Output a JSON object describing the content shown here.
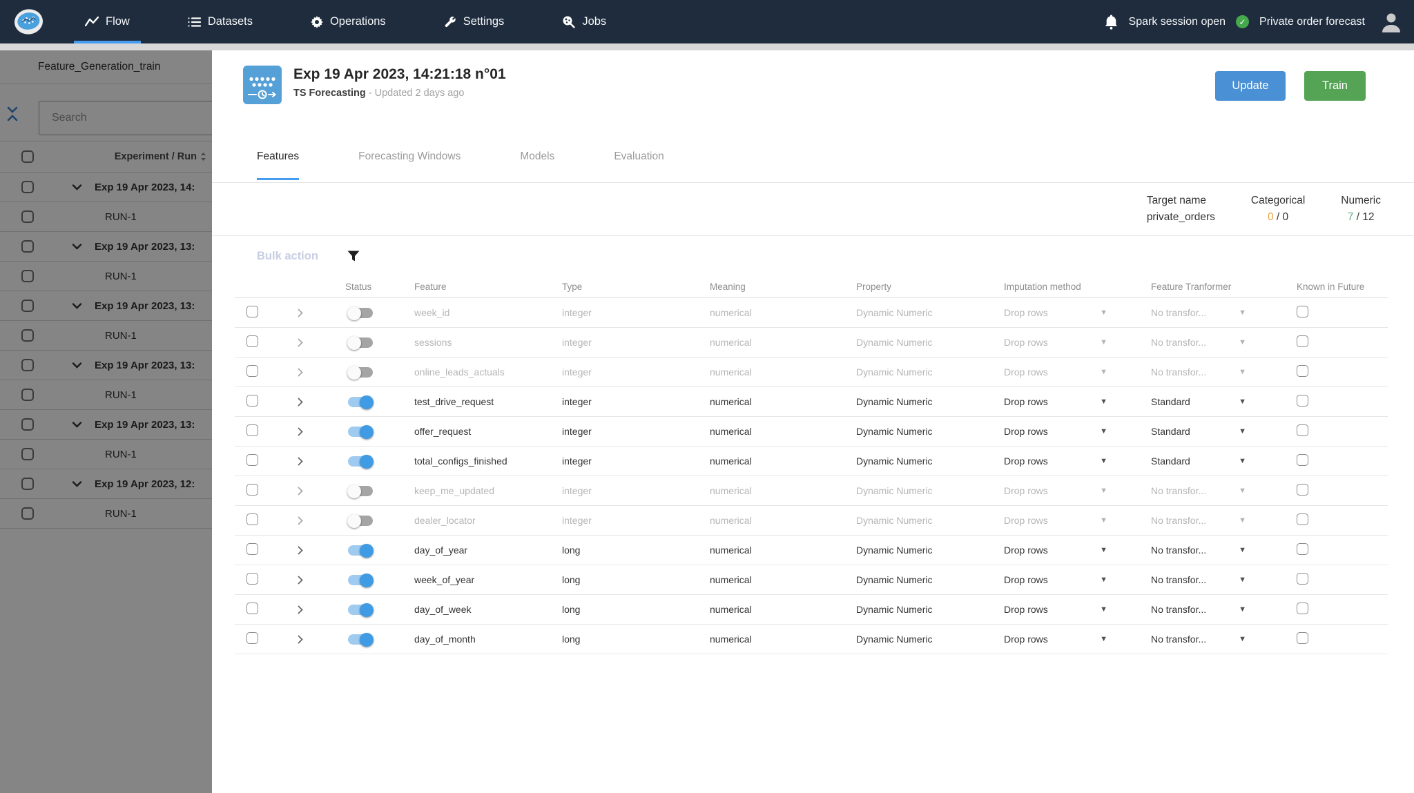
{
  "nav": {
    "items": [
      {
        "label": "Flow",
        "icon": "flow-icon",
        "active": true
      },
      {
        "label": "Datasets",
        "icon": "datasets-icon",
        "active": false
      },
      {
        "label": "Operations",
        "icon": "operations-icon",
        "active": false
      },
      {
        "label": "Settings",
        "icon": "settings-icon",
        "active": false
      },
      {
        "label": "Jobs",
        "icon": "jobs-icon",
        "active": false
      }
    ],
    "right": {
      "spark_status": "Spark session open",
      "project_name": "Private order forecast"
    }
  },
  "sidebar": {
    "title": "Feature_Generation_train",
    "search_placeholder": "Search",
    "column_header": "Experiment / Run",
    "rows": [
      {
        "type": "experiment",
        "label": "Exp 19 Apr 2023, 14:"
      },
      {
        "type": "run",
        "label": "RUN-1"
      },
      {
        "type": "experiment",
        "label": "Exp 19 Apr 2023, 13:"
      },
      {
        "type": "run",
        "label": "RUN-1"
      },
      {
        "type": "experiment",
        "label": "Exp 19 Apr 2023, 13:"
      },
      {
        "type": "run",
        "label": "RUN-1"
      },
      {
        "type": "experiment",
        "label": "Exp 19 Apr 2023, 13:"
      },
      {
        "type": "run",
        "label": "RUN-1"
      },
      {
        "type": "experiment",
        "label": "Exp 19 Apr 2023, 13:"
      },
      {
        "type": "run",
        "label": "RUN-1"
      },
      {
        "type": "experiment",
        "label": "Exp 19 Apr 2023, 12:"
      },
      {
        "type": "run",
        "label": "RUN-1"
      }
    ]
  },
  "main": {
    "experiment": {
      "title": "Exp 19 Apr 2023, 14:21:18 n°01",
      "subtitle": "TS Forecasting",
      "updated": " - Updated 2 days ago"
    },
    "actions": {
      "update": "Update",
      "train": "Train"
    },
    "tabs": [
      {
        "label": "Features",
        "active": true
      },
      {
        "label": "Forecasting Windows",
        "active": false
      },
      {
        "label": "Models",
        "active": false
      },
      {
        "label": "Evaluation",
        "active": false
      }
    ],
    "stats": {
      "target_label": "Target name",
      "target_value": "private_orders",
      "categorical_label": "Categorical",
      "categorical_enabled": "0",
      "categorical_rest": " / 0",
      "numeric_label": "Numeric",
      "numeric_enabled": "7",
      "numeric_rest": " / 12"
    },
    "bulk_action_label": "Bulk action",
    "table": {
      "headers": {
        "status": "Status",
        "feature": "Feature",
        "type": "Type",
        "meaning": "Meaning",
        "property": "Property",
        "imputation": "Imputation method",
        "transformer": "Feature Tranformer",
        "known": "Known in Future"
      },
      "rows": [
        {
          "state": "off",
          "feature": "week_id",
          "type": "integer",
          "meaning": "numerical",
          "property": "Dynamic Numeric",
          "imputation": "Drop rows",
          "transformer": "No transfor..."
        },
        {
          "state": "off",
          "feature": "sessions",
          "type": "integer",
          "meaning": "numerical",
          "property": "Dynamic Numeric",
          "imputation": "Drop rows",
          "transformer": "No transfor..."
        },
        {
          "state": "off",
          "feature": "online_leads_actuals",
          "type": "integer",
          "meaning": "numerical",
          "property": "Dynamic Numeric",
          "imputation": "Drop rows",
          "transformer": "No transfor..."
        },
        {
          "state": "on",
          "feature": "test_drive_request",
          "type": "integer",
          "meaning": "numerical",
          "property": "Dynamic Numeric",
          "imputation": "Drop rows",
          "transformer": "Standard"
        },
        {
          "state": "on",
          "feature": "offer_request",
          "type": "integer",
          "meaning": "numerical",
          "property": "Dynamic Numeric",
          "imputation": "Drop rows",
          "transformer": "Standard"
        },
        {
          "state": "on",
          "feature": "total_configs_finished",
          "type": "integer",
          "meaning": "numerical",
          "property": "Dynamic Numeric",
          "imputation": "Drop rows",
          "transformer": "Standard"
        },
        {
          "state": "off",
          "feature": "keep_me_updated",
          "type": "integer",
          "meaning": "numerical",
          "property": "Dynamic Numeric",
          "imputation": "Drop rows",
          "transformer": "No transfor..."
        },
        {
          "state": "off",
          "feature": "dealer_locator",
          "type": "integer",
          "meaning": "numerical",
          "property": "Dynamic Numeric",
          "imputation": "Drop rows",
          "transformer": "No transfor..."
        },
        {
          "state": "on",
          "feature": "day_of_year",
          "type": "long",
          "meaning": "numerical",
          "property": "Dynamic Numeric",
          "imputation": "Drop rows",
          "transformer": "No transfor..."
        },
        {
          "state": "on",
          "feature": "week_of_year",
          "type": "long",
          "meaning": "numerical",
          "property": "Dynamic Numeric",
          "imputation": "Drop rows",
          "transformer": "No transfor..."
        },
        {
          "state": "on",
          "feature": "day_of_week",
          "type": "long",
          "meaning": "numerical",
          "property": "Dynamic Numeric",
          "imputation": "Drop rows",
          "transformer": "No transfor..."
        },
        {
          "state": "on",
          "feature": "day_of_month",
          "type": "long",
          "meaning": "numerical",
          "property": "Dynamic Numeric",
          "imputation": "Drop rows",
          "transformer": "No transfor..."
        }
      ]
    }
  },
  "colors": {
    "nav_background": "#1f2c3d",
    "accent_blue": "#459cf0",
    "update_button_blue": "#4a90d5",
    "train_button_green": "#55a455",
    "toggle_on_blue": "#3e9be4",
    "status_check_green": "#46a84c",
    "categorical_orange": "#e8a33d",
    "numeric_green": "#5fa97c"
  }
}
